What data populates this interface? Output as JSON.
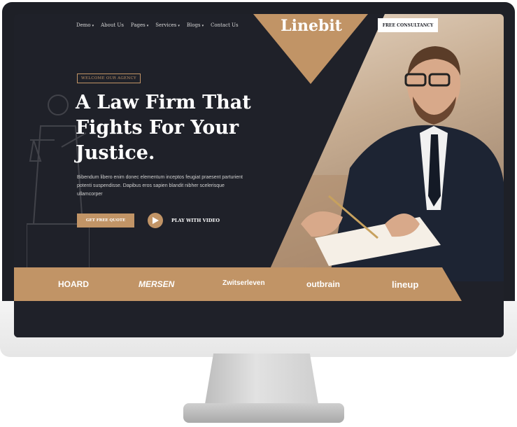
{
  "nav": {
    "items": [
      {
        "label": "Demo",
        "caret": "▾"
      },
      {
        "label": "About Us",
        "caret": ""
      },
      {
        "label": "Pages",
        "caret": "▾"
      },
      {
        "label": "Services",
        "caret": "▾"
      },
      {
        "label": "Blogs",
        "caret": "▾"
      },
      {
        "label": "Contact Us",
        "caret": ""
      }
    ],
    "logo": "Linebit",
    "cta": "FREE CONSULTANCY"
  },
  "hero": {
    "badge": "WELCOME OUR AGENCY",
    "headline_lines": [
      "A Law Firm That",
      "Fights For Your",
      "Justice."
    ],
    "description": "Bibendum libero enim donec elementum inceptos feugiat praesent parturient potenti suspendisse. Dapibus eros sapien blandit nibher scelerisque ullamcorper",
    "quote_button": "GET FREE QUOTE",
    "video_label": "PLAY WITH VIDEO"
  },
  "clients": [
    "HOARD",
    "MERSEN",
    "Zwitserleven",
    "outbrain",
    "lineup"
  ],
  "colors": {
    "accent": "#c19466",
    "dark": "#1f2129",
    "white": "#ffffff"
  },
  "icons": {
    "play": "play-icon",
    "statue": "justice-statue-icon"
  }
}
